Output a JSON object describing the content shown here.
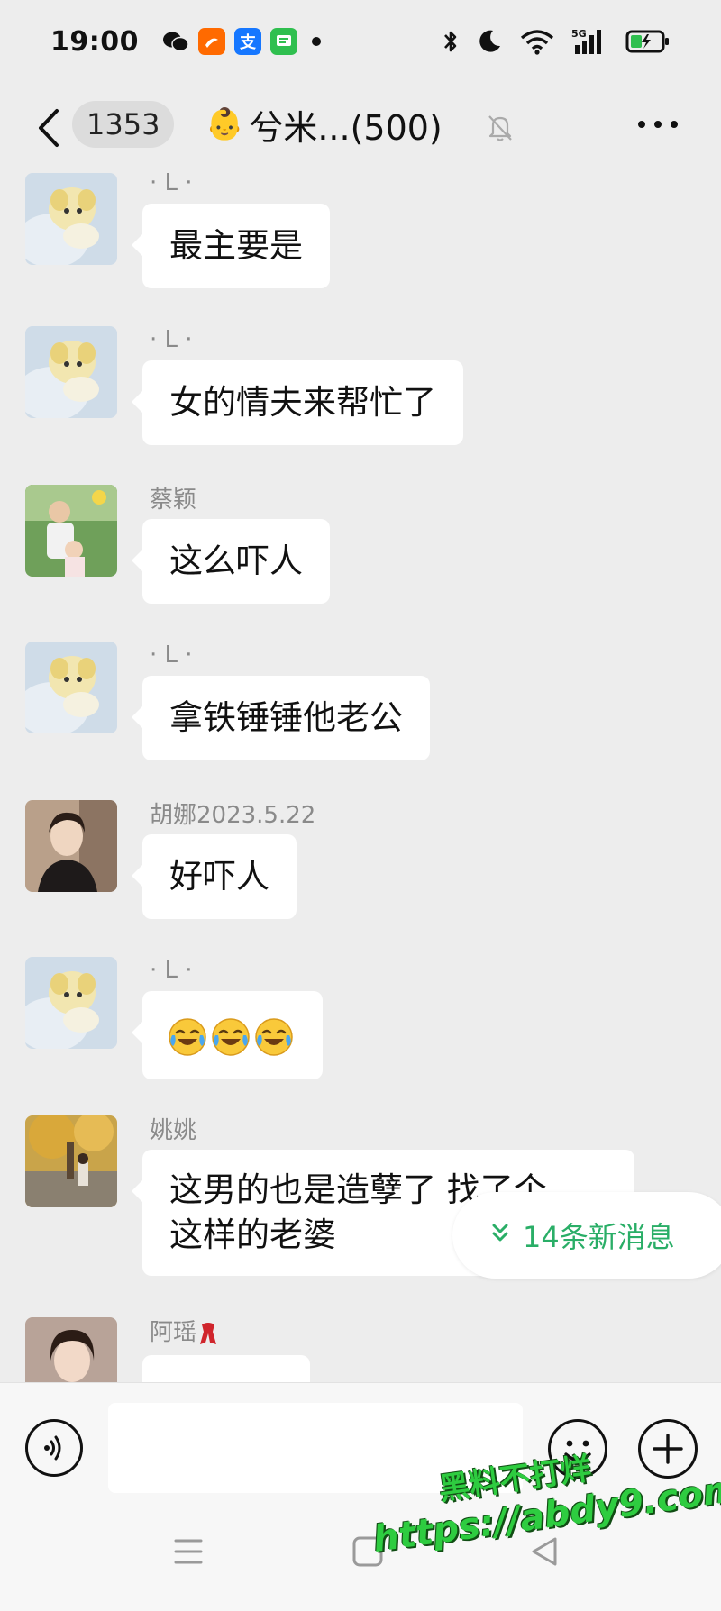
{
  "status_bar": {
    "time": "19:00",
    "apps": [
      "wechat-icon",
      "taobao-icon",
      "alipay-icon",
      "messages-icon"
    ],
    "alipay_glyph": "支",
    "network": "5G"
  },
  "header": {
    "unread_count": "1353",
    "title_emoji": "👶",
    "title": "兮米...(500)"
  },
  "messages": [
    {
      "sender": "· L ·",
      "text": "最主要是",
      "avatar": "plush-toy-avatar"
    },
    {
      "sender": "· L ·",
      "text": "女的情夫来帮忙了",
      "avatar": "plush-toy-avatar"
    },
    {
      "sender": "蔡颖",
      "text": "这么吓人",
      "avatar": "family-photo-avatar"
    },
    {
      "sender": "· L ·",
      "text": "拿铁锤锤他老公",
      "avatar": "plush-toy-avatar"
    },
    {
      "sender": "胡娜2023.5.22",
      "text": "好吓人",
      "avatar": "portrait-avatar"
    },
    {
      "sender": "· L ·",
      "emoji_count": 3,
      "emoji": "crying-laughing-emoji",
      "avatar": "plush-toy-avatar"
    },
    {
      "sender": "姚姚",
      "text_line1": "这男的也是造孽了 找了个",
      "text_line2": "这样的老婆",
      "avatar": "autumn-tree-avatar"
    },
    {
      "sender": "阿瑶",
      "text": "",
      "avatar": "woman-portrait-avatar"
    }
  ],
  "new_messages_pill": {
    "chevron": "»",
    "label": "14条新消息"
  },
  "input_bar": {
    "placeholder": ""
  },
  "watermark": {
    "line1": "黑料不打烊",
    "line2": "https://abdy9.com"
  },
  "colors": {
    "background": "#ededed",
    "bubble": "#ffffff",
    "accent_green": "#2aae67",
    "watermark_green": "#2ecc40"
  }
}
